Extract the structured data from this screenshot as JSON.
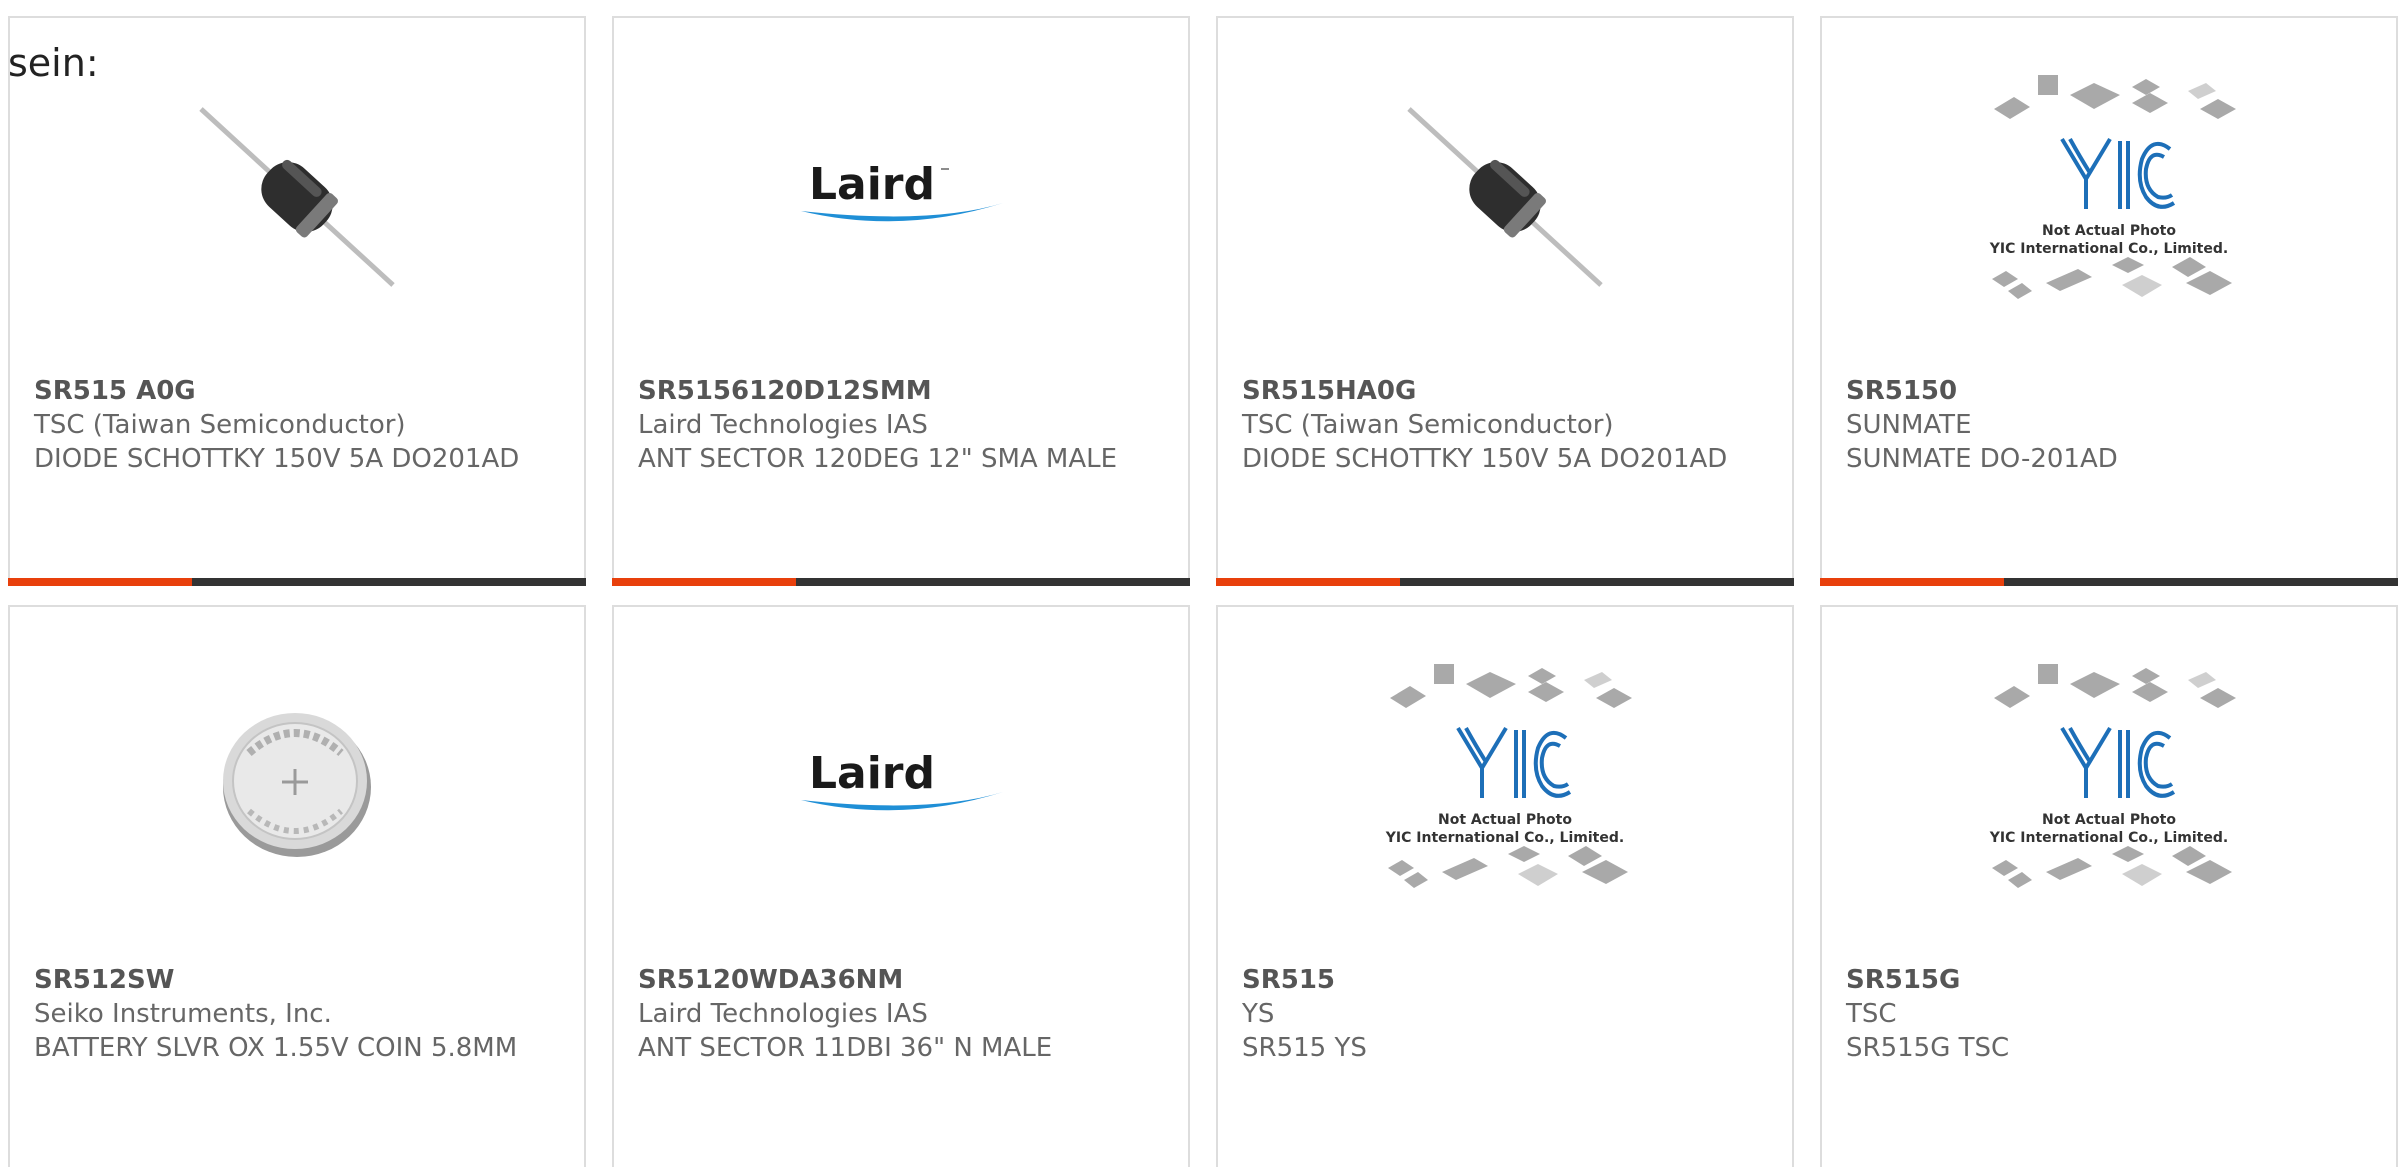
{
  "intro_text": "sein:",
  "colors": {
    "accent": "#e8400c",
    "bar": "#333333",
    "border": "#dddddd",
    "text": "#666666"
  },
  "cards": [
    {
      "part_number": "SR515 A0G",
      "manufacturer": "TSC (Taiwan Semiconductor)",
      "description": "DIODE SCHOTTKY 150V 5A DO201AD",
      "image": "axial-diode-image"
    },
    {
      "part_number": "SR5156120D12SMM",
      "manufacturer": "Laird Technologies IAS",
      "description": "ANT SECTOR 120DEG 12\" SMA MALE",
      "image": "laird-logo-image",
      "logo_text": "Laird"
    },
    {
      "part_number": "SR515HA0G",
      "manufacturer": "TSC (Taiwan Semiconductor)",
      "description": "DIODE SCHOTTKY 150V 5A DO201AD",
      "image": "axial-diode-image"
    },
    {
      "part_number": "SR5150",
      "manufacturer": "SUNMATE",
      "description": "SUNMATE DO-201AD",
      "image": "yic-placeholder-image",
      "placeholder_line1": "Not Actual Photo",
      "placeholder_line2": "YIC International Co., Limited."
    },
    {
      "part_number": "SR512SW",
      "manufacturer": "Seiko Instruments, Inc.",
      "description": "BATTERY SLVR OX 1.55V COIN 5.8MM",
      "image": "coin-battery-image"
    },
    {
      "part_number": "SR5120WDA36NM",
      "manufacturer": "Laird Technologies IAS",
      "description": "ANT SECTOR 11DBI 36\" N MALE",
      "image": "laird-logo-image",
      "logo_text": "Laird"
    },
    {
      "part_number": "SR515",
      "manufacturer": "YS",
      "description": "SR515 YS",
      "image": "yic-placeholder-image",
      "placeholder_line1": "Not Actual Photo",
      "placeholder_line2": "YIC International Co., Limited."
    },
    {
      "part_number": "SR515G",
      "manufacturer": "TSC",
      "description": "SR515G TSC",
      "image": "yic-placeholder-image",
      "placeholder_line1": "Not Actual Photo",
      "placeholder_line2": "YIC International Co., Limited."
    }
  ]
}
